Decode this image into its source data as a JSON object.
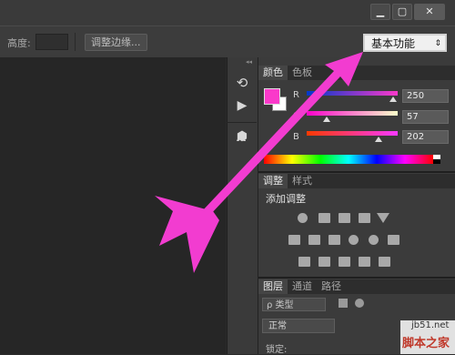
{
  "window": {
    "minimize_label": "▁",
    "restore_label": "▢",
    "close_label": "✕"
  },
  "options": {
    "height_label": "高度:",
    "refine_edge_label": "调整边缘..."
  },
  "workspace": {
    "selected": "基本功能",
    "arrow": "⇕"
  },
  "tools": {
    "collapse_left": "◂◂",
    "collapse_right": "▸▸",
    "history_glyph": "⟲",
    "play_glyph": "▶",
    "cube_glyph": "⬢",
    "char_glyph": "A"
  },
  "color_panel": {
    "tabs": [
      "颜色",
      "色板"
    ],
    "channels": [
      {
        "label": "R",
        "value": "250"
      },
      {
        "label": "G",
        "value": "57"
      },
      {
        "label": "B",
        "value": "202"
      }
    ],
    "foreground": "#fa39ca"
  },
  "adjust_panel": {
    "tabs": [
      "调整",
      "样式"
    ],
    "title": "添加调整"
  },
  "layers_panel": {
    "tabs": [
      "图层",
      "通道",
      "路径"
    ],
    "filter_label": "ρ 类型",
    "blend_mode": "正常",
    "lock_label": "锁定:"
  },
  "watermark": {
    "site": "jb51.net",
    "brand": "脚本之家"
  },
  "colors": {
    "arrow": "#f23cd0",
    "accent": "#fa39ca"
  }
}
